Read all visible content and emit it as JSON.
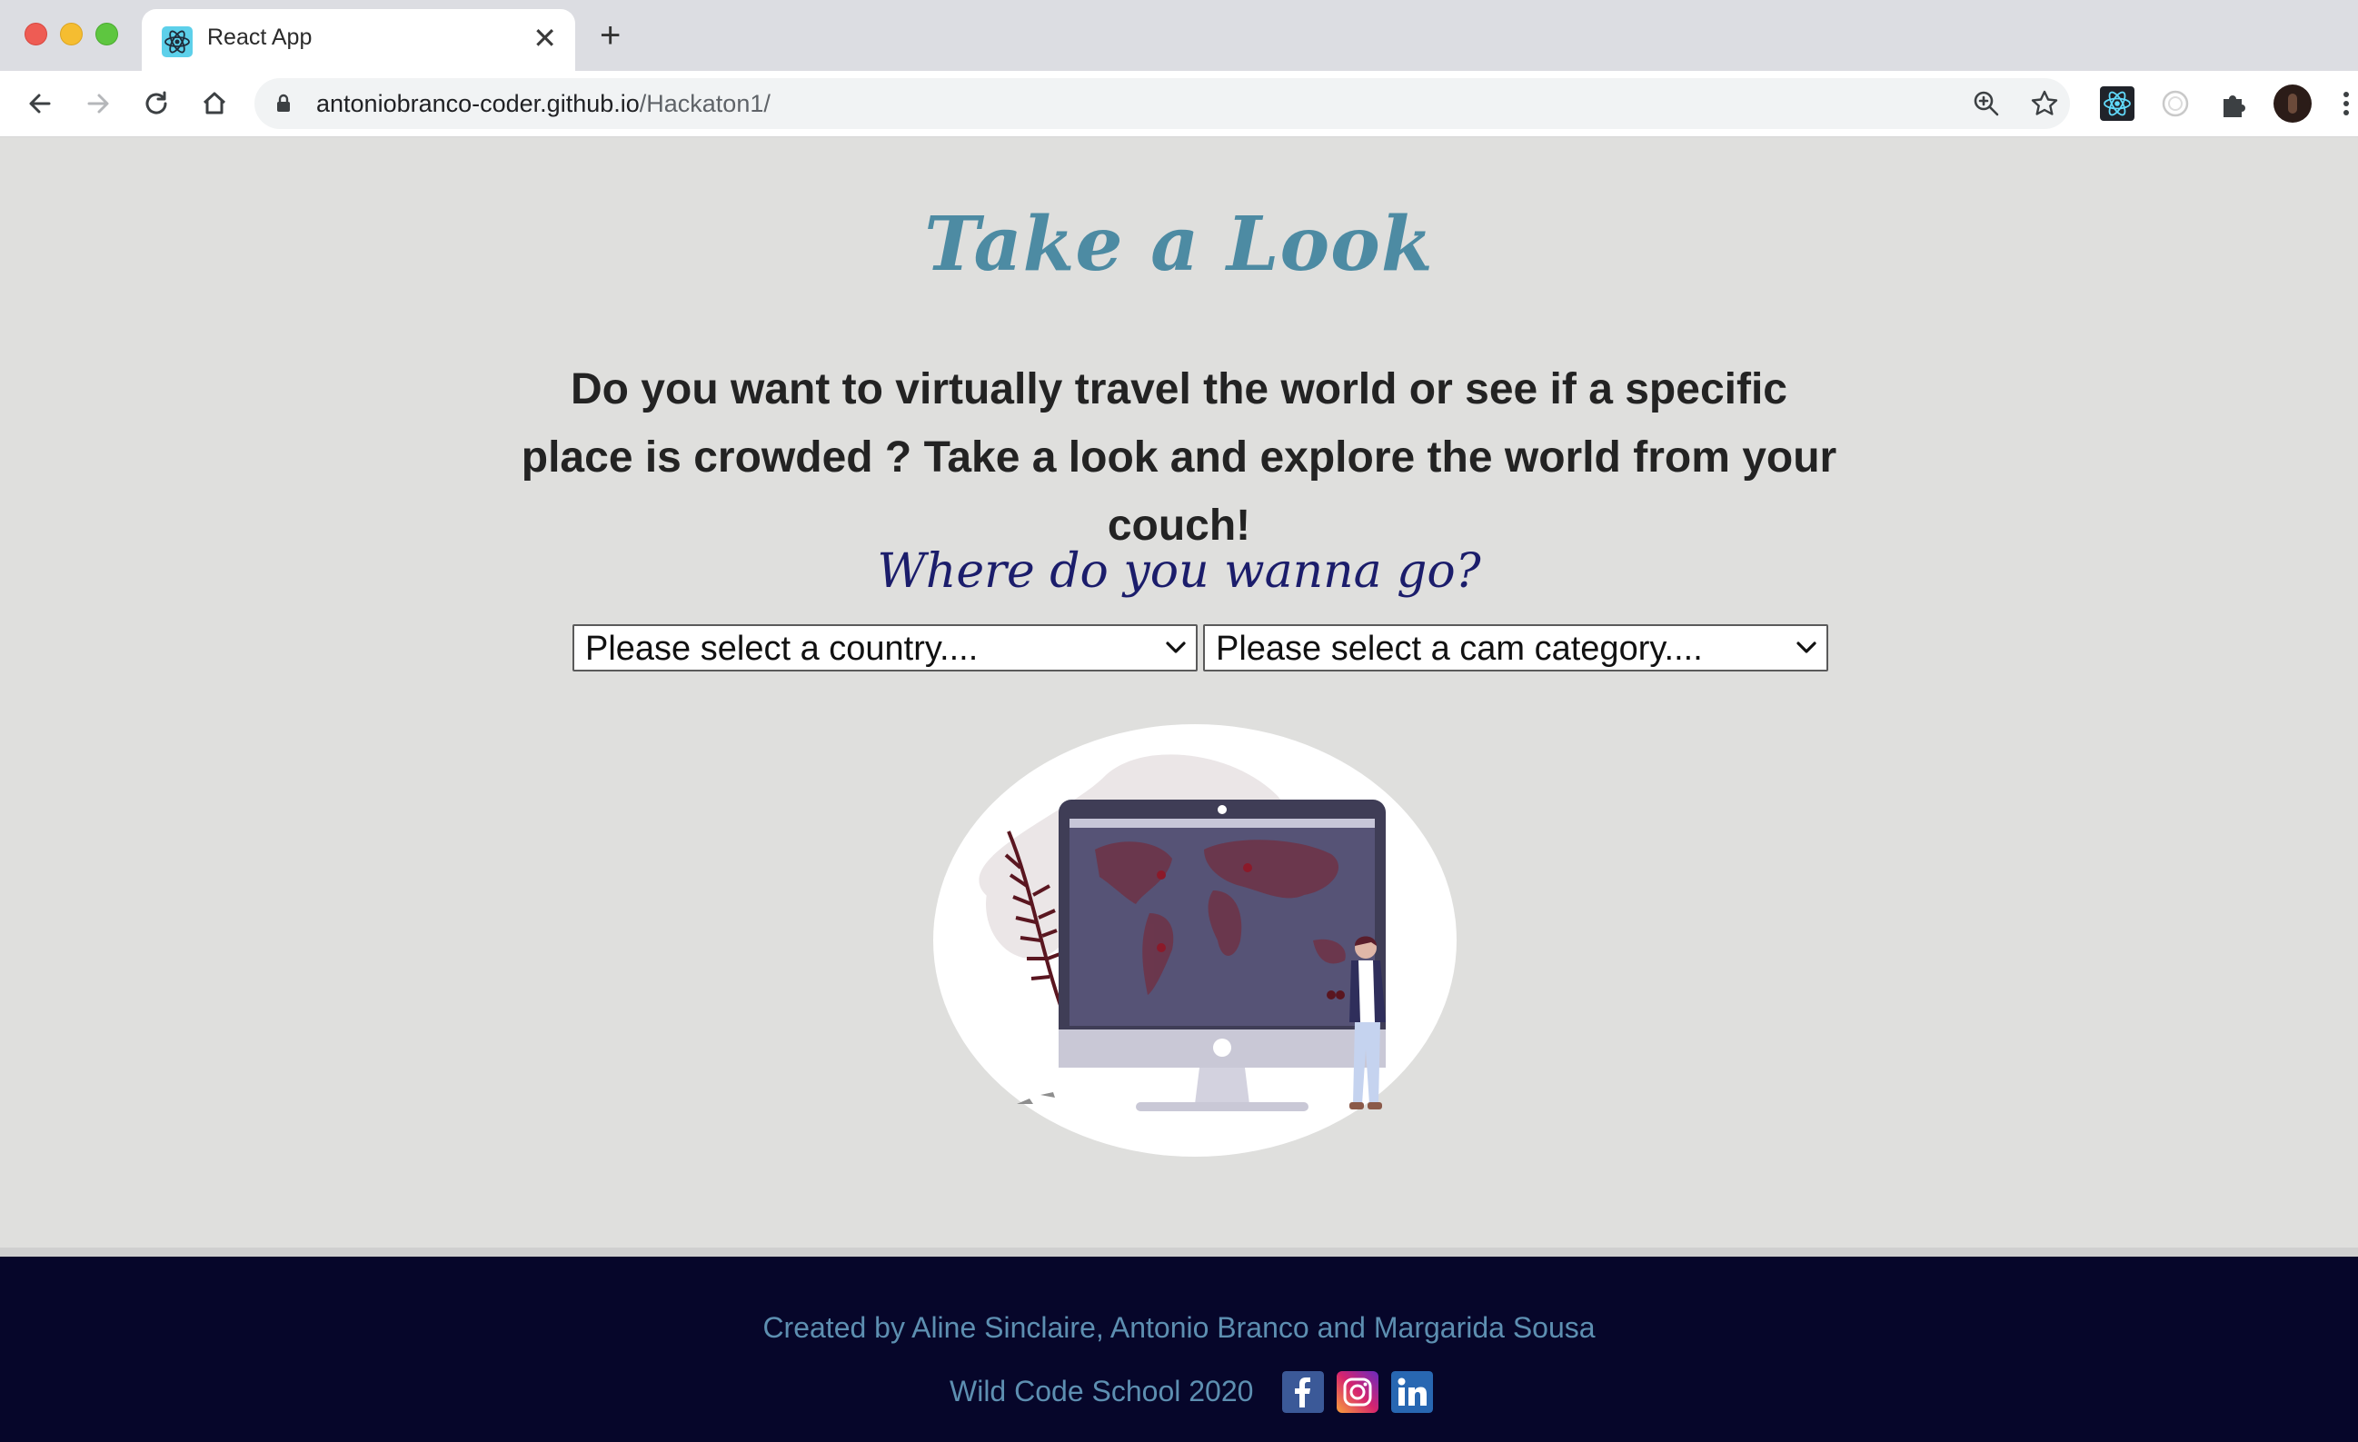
{
  "browser": {
    "tab_title": "React App",
    "url_host": "antoniobranco-coder.github.io",
    "url_path": "/Hackaton1/",
    "icons": [
      "back-icon",
      "forward-icon",
      "reload-icon",
      "home-icon",
      "lock-icon",
      "zoom-icon",
      "bookmark-star-icon",
      "react-devtools-icon",
      "extension-icon",
      "puzzle-icon",
      "profile-avatar",
      "menu-kebab-icon"
    ]
  },
  "main": {
    "title": "Take a Look",
    "intro": "Do you want to virtually travel the world or see if a specific place is crowded ? Take a look and explore the world from your couch!",
    "prompt": "Where do you wanna go?",
    "country_select": "Please select a country....",
    "category_select": "Please select a cam category...."
  },
  "footer": {
    "credits": "Created by Aline Sinclaire, Antonio Branco and Margarida Sousa",
    "school": "Wild Code School 2020",
    "social": [
      "facebook-icon",
      "instagram-icon",
      "linkedin-icon"
    ]
  },
  "colors": {
    "title": "#4d8ba3",
    "prompt": "#1b1d6b",
    "page_bg": "#dfdfdd",
    "footer_bg": "#06062a",
    "footer_text": "#5d8fb1"
  }
}
